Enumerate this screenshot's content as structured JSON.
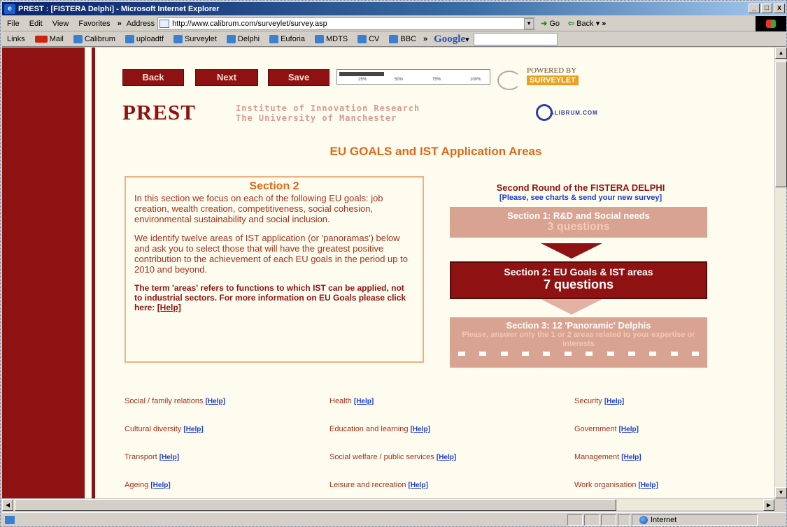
{
  "window": {
    "title": "PREST : [FISTERA Delphi] - Microsoft Internet Explorer",
    "controls": [
      "_",
      "□",
      "x"
    ]
  },
  "menu": {
    "items": [
      "File",
      "Edit",
      "View",
      "Favorites"
    ],
    "overflow": "»",
    "address_label": "Address",
    "address_url": "http://www.calibrum.com/surveylet/survey.asp",
    "go_label": "Go",
    "back_label": "Back"
  },
  "links_bar": {
    "label": "Links",
    "items": [
      "Mail",
      "Calibrum",
      "uploadtf",
      "Surveylet",
      "Delphi",
      "Euforia",
      "MDTS",
      "CV",
      "BBC"
    ],
    "google_label": "Google"
  },
  "survey_nav": {
    "back": "Back",
    "next": "Next",
    "save": "Save",
    "progress_fraction": 0.3,
    "progress_ticks": [
      "25%",
      "50%",
      "75%",
      "100%"
    ],
    "powered_by": "POWERED BY",
    "surveylet": "SURVEYLET"
  },
  "branding": {
    "prest": "PREST",
    "institute_line1": "Institute of Innovation Research",
    "institute_line2": "The University of Manchester",
    "calibrum": "ALIBRUM.COM"
  },
  "page": {
    "heading": "EU GOALS and IST Application Areas"
  },
  "section_box": {
    "title": "Section 2",
    "para1": "In this section we focus on each of the following EU goals: job creation, wealth creation, competitiveness, social cohesion, environmental sustainability and social inclusion.",
    "para2": "We identify twelve areas of IST application (or 'panoramas') below and ask you to select those that will have the greatest positive contribution to the achievement of each EU goals in the period up to 2010 and beyond.",
    "note": "The term 'areas' refers to functions to which IST can be applied, not to industrial sectors. For more information on EU Goals please click here:",
    "note_link": "[Help]"
  },
  "round": {
    "title": "Second Round of the FISTERA DELPHI",
    "subtitle": "[Please, see charts & send your new survey]",
    "sec1_a": "Section 1: R&D and Social needs",
    "sec1_b": "3 questions",
    "sec2_a": "Section 2: EU Goals & IST areas",
    "sec2_b": "7 questions",
    "sec3_a": "Section 3: 12 'Panoramic' Delphis",
    "sec3_b": "Please, answer only the 1 or 2 areas related to your expertise or interests"
  },
  "areas": {
    "help_label": "[Help]",
    "items": [
      "Social / family relations",
      "Health",
      "Security",
      "Cultural diversity",
      "Education and learning",
      "Government",
      "Transport",
      "Social welfare / public services",
      "Management",
      "Ageing",
      "Leisure and recreation",
      "Work organisation"
    ]
  },
  "status": {
    "zone": "Internet"
  }
}
